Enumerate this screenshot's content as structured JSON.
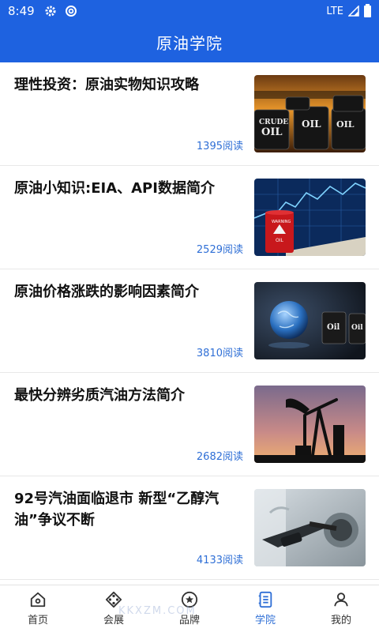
{
  "status": {
    "time": "8:49",
    "network": "LTE"
  },
  "header": {
    "title": "原油学院"
  },
  "articles": [
    {
      "title": "理性投资：原油实物知识攻略",
      "reads": "1395阅读",
      "thumb_text": "CRUDE OIL"
    },
    {
      "title": "原油小知识:EIA、API数据简介",
      "reads": "2529阅读",
      "thumb_text": "WARNING OIL"
    },
    {
      "title": "原油价格涨跌的影响因素简介",
      "reads": "3810阅读",
      "thumb_text": "Oil"
    },
    {
      "title": "最快分辨劣质汽油方法简介",
      "reads": "2682阅读"
    },
    {
      "title": "92号汽油面临退市 新型“乙醇汽油”争议不断",
      "reads": "4133阅读"
    }
  ],
  "tabs": [
    {
      "label": "首页",
      "icon": "home-icon"
    },
    {
      "label": "会展",
      "icon": "exhibition-icon"
    },
    {
      "label": "品牌",
      "icon": "brand-star-icon"
    },
    {
      "label": "学院",
      "icon": "academy-book-icon"
    },
    {
      "label": "我的",
      "icon": "user-icon"
    }
  ],
  "watermark": "KKXZM.COM",
  "colors": {
    "primary": "#1e62e0",
    "active_tab": "#2f6fd6",
    "read_count": "#2f6fd6"
  }
}
